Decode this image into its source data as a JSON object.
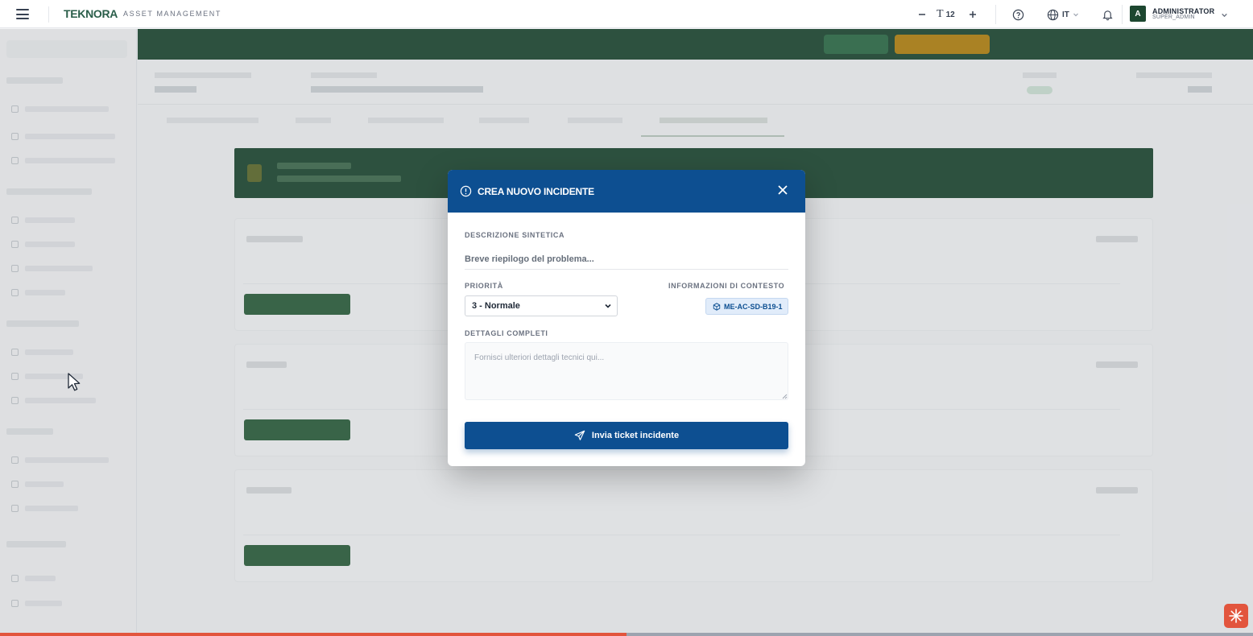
{
  "app": {
    "logo": "TEKNORA",
    "logo_subtitle": "ASSET MANAGEMENT"
  },
  "topbar": {
    "font_size_label": "T",
    "font_size_value": "12",
    "language": "IT",
    "user_name": "ADMINISTRATOR",
    "user_role": "SUPER_ADMIN",
    "avatar_letter": "A"
  },
  "modal": {
    "title": "CREA NUOVO INCIDENTE",
    "short_description_label": "DESCRIZIONE SINTETICA",
    "short_description_placeholder": "Breve riepilogo del problema...",
    "priority_label": "PRIORITÀ",
    "priority_value": "3 - Normale",
    "context_label": "INFORMAZIONI DI CONTESTO",
    "context_tag": "ME-AC-SD-B19-1",
    "details_label": "DETTAGLI COMPLETI",
    "details_placeholder": "Fornisci ulteriori dettagli tecnici qui...",
    "submit_label": "Invia ticket incidente"
  },
  "colors": {
    "modal_header": "#0d4f91",
    "primary_green": "#1d4730",
    "accent_orange": "#e2553d"
  },
  "progress": {
    "fraction": 0.5
  }
}
